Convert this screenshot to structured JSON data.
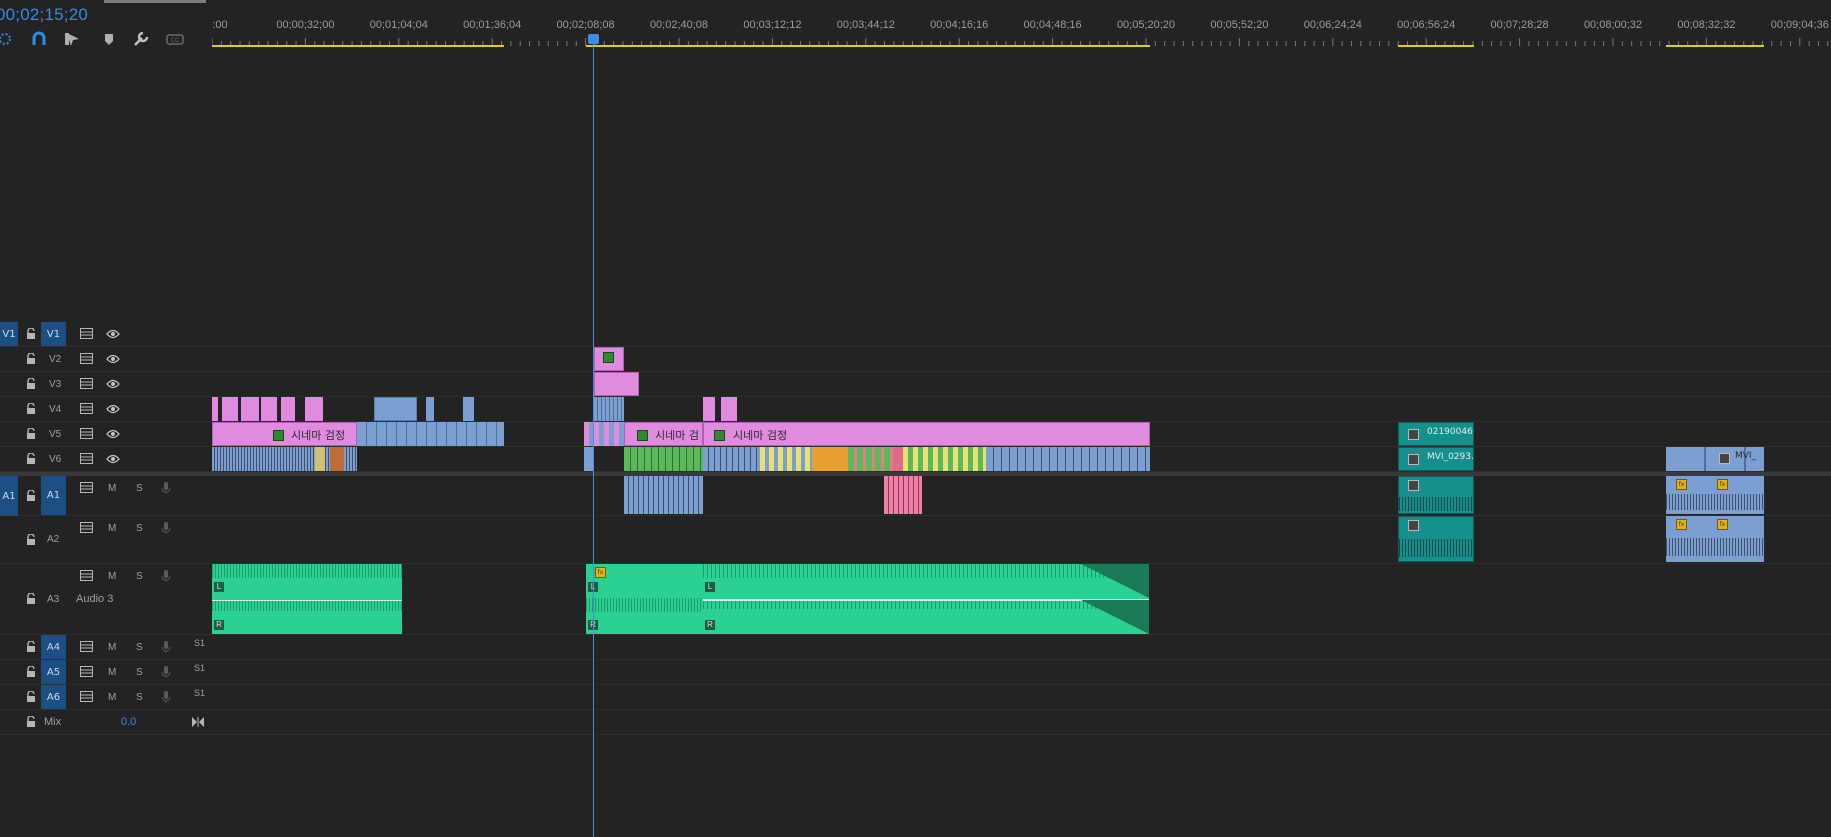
{
  "timecode": "00;02;15;20",
  "ruler": {
    "labels": [
      ":00",
      "00;00;32;00",
      "00;01;04;04",
      "00;01;36;04",
      "00;02;08;08",
      "00;02;40;08",
      "00;03;12;12",
      "00;03;44;12",
      "00;04;16;16",
      "00;04;48;16",
      "00;05;20;20",
      "00;05;52;20",
      "00;06;24;24",
      "00;06;56;24",
      "00;07;28;28",
      "00;08;00;32",
      "00;08;32;32",
      "00;09;04;36"
    ]
  },
  "tools": [
    "snap-icon",
    "magnet-icon",
    "linked-selection-icon",
    "marker-icon",
    "wrench-icon",
    "captions-icon"
  ],
  "video_tracks": [
    {
      "id": "V6",
      "target": ""
    },
    {
      "id": "V5",
      "target": ""
    },
    {
      "id": "V4",
      "target": ""
    },
    {
      "id": "V3",
      "target": ""
    },
    {
      "id": "V2",
      "target": ""
    },
    {
      "id": "V1",
      "target": "V1"
    }
  ],
  "audio_tracks": [
    {
      "id": "A1",
      "target": "A1",
      "name": "",
      "m": "M",
      "s": "S"
    },
    {
      "id": "A2",
      "target": "",
      "name": "",
      "m": "M",
      "s": "S"
    },
    {
      "id": "A3",
      "target": "",
      "name": "Audio 3",
      "m": "M",
      "s": "S"
    },
    {
      "id": "A4",
      "target": "",
      "name": "",
      "m": "M",
      "s": "S",
      "sub": "S1"
    },
    {
      "id": "A5",
      "target": "",
      "name": "",
      "m": "M",
      "s": "S",
      "sub": "S1"
    },
    {
      "id": "A6",
      "target": "",
      "name": "",
      "m": "M",
      "s": "S",
      "sub": "S1"
    }
  ],
  "mix": {
    "label": "Mix",
    "value": "0.0"
  },
  "clips": {
    "v2_title_1": "시네마 검정",
    "v2_title_2": "시네마 검",
    "v2_title_3": "시네마 검정",
    "v2_teal": "02190046.",
    "v1_teal": "MVI_0293.",
    "v1_blue": "MVI_"
  },
  "audio_channels": {
    "left": "L",
    "right": "R"
  },
  "colors": {
    "accent": "#2d8ceb",
    "pink": "#e08be0",
    "blue": "#7a9fd0",
    "green_audio": "#2ad192",
    "teal": "#158f8c",
    "target_blue": "#1d4f84"
  }
}
